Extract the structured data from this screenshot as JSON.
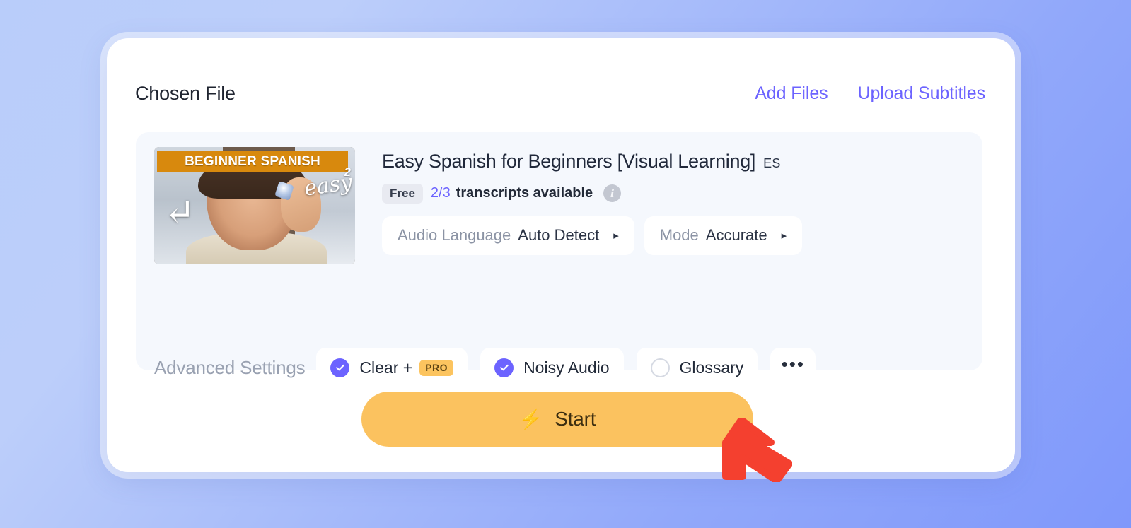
{
  "header": {
    "title": "Chosen File",
    "actions": [
      {
        "label": "Add Files",
        "name": "add-files-link"
      },
      {
        "label": "Upload Subtitles",
        "name": "upload-subtitles-link"
      }
    ]
  },
  "file": {
    "title": "Easy Spanish for Beginners [Visual Learning]",
    "language_code": "ES",
    "plan_badge": "Free",
    "transcripts_count": "2/3",
    "transcripts_text": "transcripts available",
    "info_icon": "info-icon",
    "thumbnail": {
      "banner_text": "BEGINNER SPANISH",
      "banner_sub": "2",
      "script_text": "easy",
      "swash_text": "↵"
    },
    "dropdowns": [
      {
        "label": "Audio Language",
        "value": "Auto Detect",
        "caret": "▸",
        "name": "audio-language-dropdown"
      },
      {
        "label": "Mode",
        "value": "Accurate",
        "caret": "▸",
        "name": "mode-dropdown"
      }
    ]
  },
  "advanced": {
    "label": "Advanced Settings",
    "options": [
      {
        "label": "Clear +",
        "checked": true,
        "badge": "PRO",
        "name": "option-clear-plus"
      },
      {
        "label": "Noisy Audio",
        "checked": true,
        "badge": "",
        "name": "option-noisy-audio"
      },
      {
        "label": "Glossary",
        "checked": false,
        "badge": "",
        "name": "option-glossary"
      }
    ],
    "more_label": "•••"
  },
  "start": {
    "label": "Start",
    "icon": "⚡"
  },
  "colors": {
    "accent_purple": "#6c63ff",
    "accent_amber": "#fbc25f",
    "cursor_red": "#f4402f",
    "panel_bg": "#f5f8fd"
  }
}
